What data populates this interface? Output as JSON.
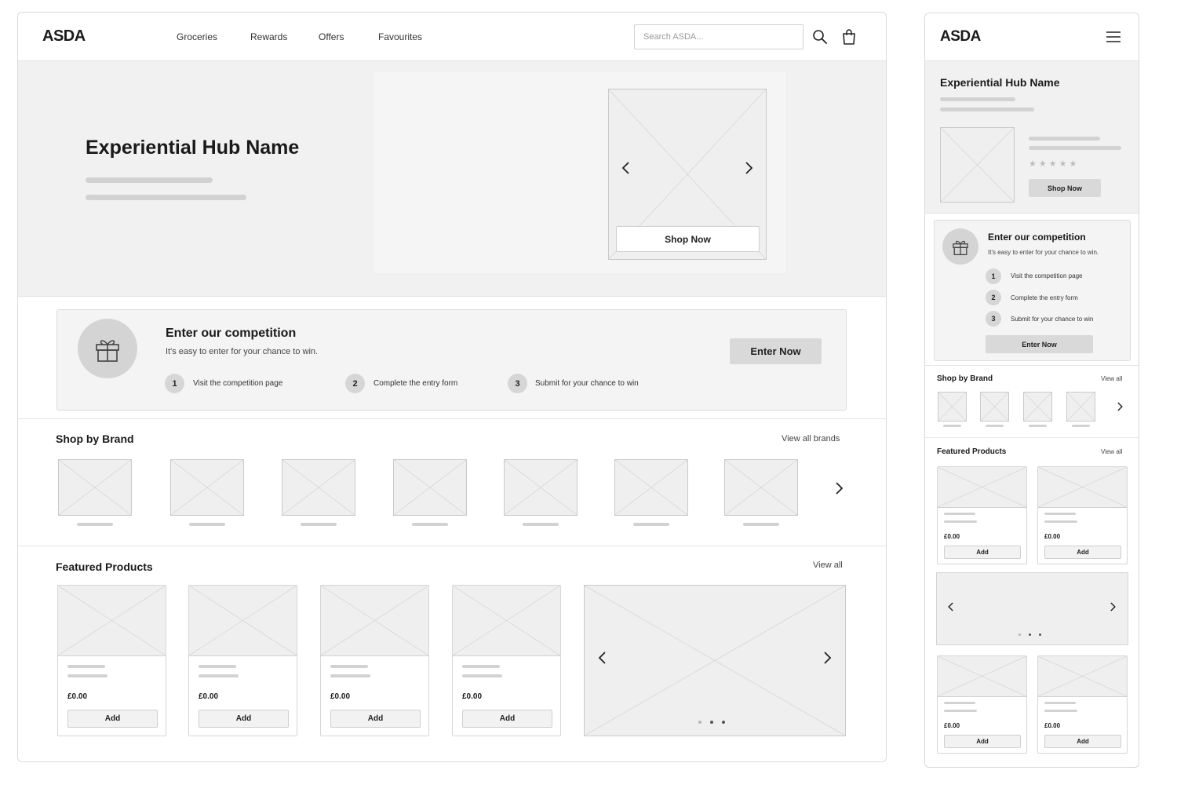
{
  "brand": {
    "logo": "ASDA"
  },
  "nav": {
    "items": [
      "Groceries",
      "Rewards",
      "Offers",
      "Favourites"
    ]
  },
  "search": {
    "placeholder": "Search ASDA...",
    "icon": "search-icon"
  },
  "cart": {
    "icon": "shopping-bag-icon"
  },
  "hero": {
    "title": "Experiential Hub Name",
    "shop_label": "Shop Now"
  },
  "competition": {
    "title": "Enter our competition",
    "subtitle": "It's easy to enter for your chance to win.",
    "cta": "Enter Now",
    "icon": "gift-icon",
    "steps": [
      {
        "num": "1",
        "label": "Visit the competition page"
      },
      {
        "num": "2",
        "label": "Complete the entry form"
      },
      {
        "num": "3",
        "label": "Submit for your chance to win"
      }
    ]
  },
  "brands": {
    "title": "Shop by Brand",
    "view_all": "View all brands",
    "count": 7
  },
  "featured": {
    "title": "Featured Products",
    "view_all": "View all",
    "products": [
      {
        "price": "£0.00",
        "add": "Add"
      },
      {
        "price": "£0.00",
        "add": "Add"
      },
      {
        "price": "£0.00",
        "add": "Add"
      },
      {
        "price": "£0.00",
        "add": "Add"
      }
    ]
  },
  "mobile": {
    "logo": "ASDA",
    "menu_icon": "hamburger-menu-icon",
    "hero_title": "Experiential Hub Name",
    "shop_label": "Shop Now",
    "rating_stars": 5,
    "competition": {
      "title": "Enter our competition",
      "subtitle": "It's easy to enter for your chance to win.",
      "cta": "Enter Now",
      "steps": [
        {
          "num": "1",
          "label": "Visit the competition page"
        },
        {
          "num": "2",
          "label": "Complete the entry form"
        },
        {
          "num": "3",
          "label": "Submit for your chance to win"
        }
      ]
    },
    "brands": {
      "title": "Shop by Brand",
      "view_all": "View all"
    },
    "featured": {
      "title": "Featured Products",
      "view_all": "View all",
      "products": [
        {
          "price": "£0.00",
          "add": "Add"
        },
        {
          "price": "£0.00",
          "add": "Add"
        },
        {
          "price": "£0.00",
          "add": "Add"
        },
        {
          "price": "£0.00",
          "add": "Add"
        }
      ]
    }
  },
  "colors": {
    "placeholder_fill": "#efefef",
    "placeholder_stroke": "#c9c9c9",
    "button_grey": "#d9d9d9",
    "hero_bg": "#f1f1f1"
  }
}
